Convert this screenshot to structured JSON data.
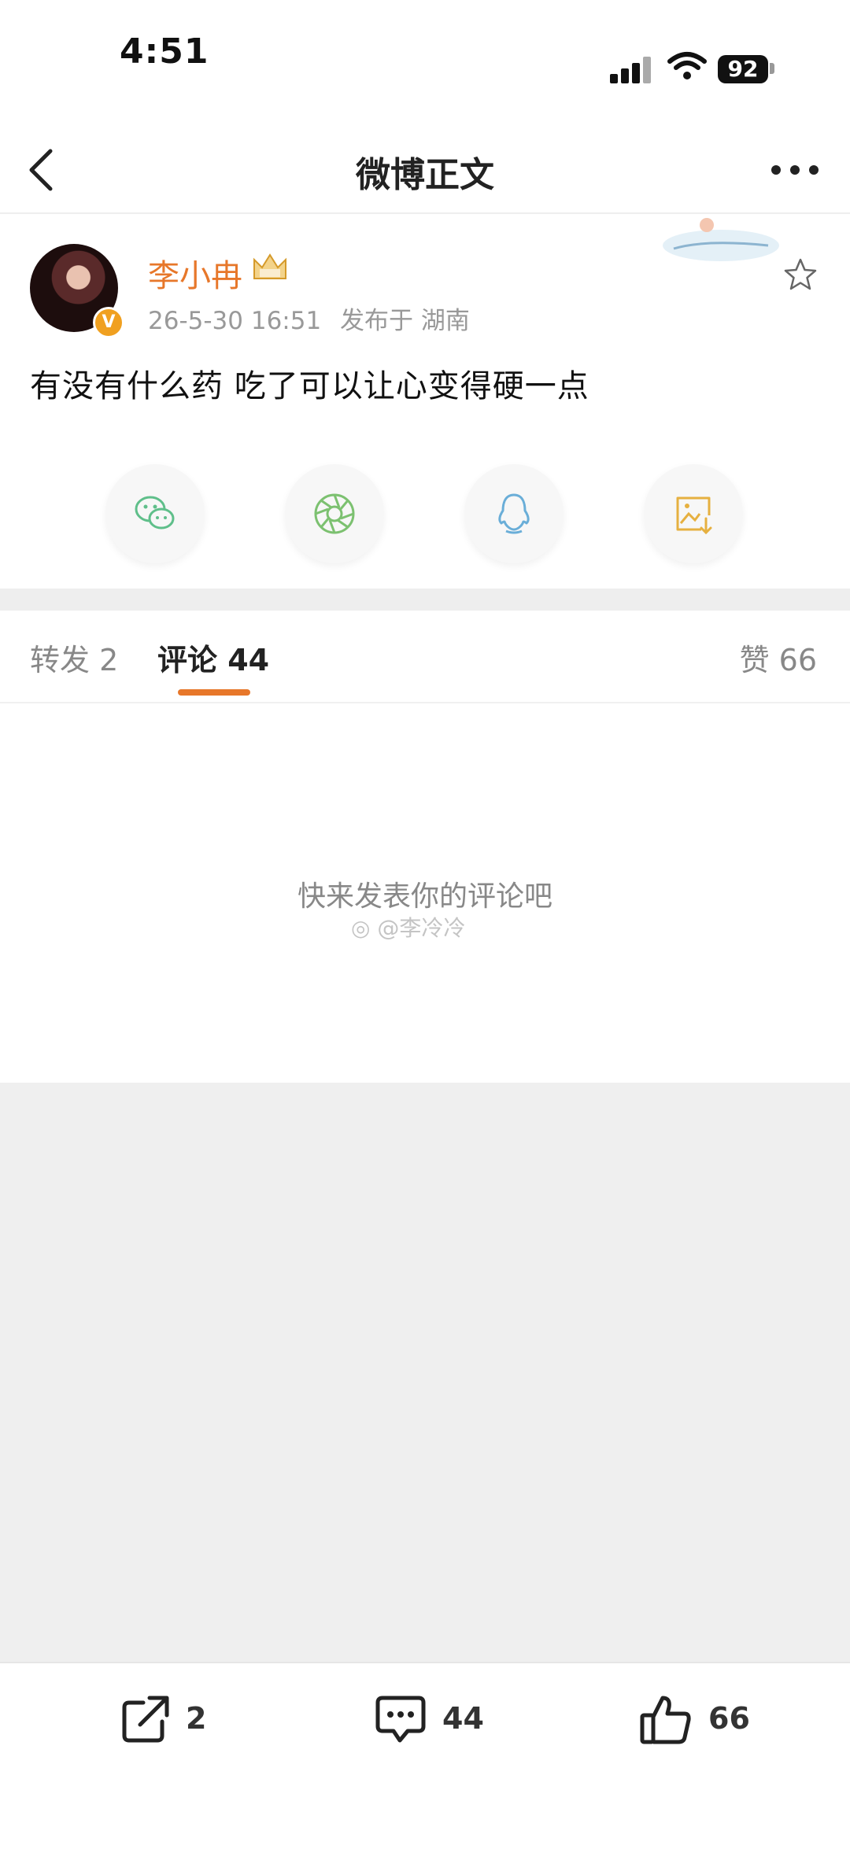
{
  "status_bar": {
    "time": "4:51",
    "battery": "92"
  },
  "nav": {
    "title": "微博正文"
  },
  "post": {
    "author": "李小冉",
    "timestamp": "26-5-30 16:51",
    "location": "发布于 湖南",
    "text": "有没有什么药 吃了可以让心变得硬一点",
    "share_targets": [
      "wechat-icon",
      "moments-icon",
      "qq-icon",
      "save-image-icon"
    ]
  },
  "tabs": {
    "repost": "转发 2",
    "comment": "评论 44",
    "like": "赞 66"
  },
  "comments": {
    "empty_text": "快来发表你的评论吧",
    "watermark": "@李冷冷"
  },
  "toolbar": {
    "repost_count": "2",
    "comment_count": "44",
    "like_count": "66"
  },
  "colors": {
    "accent": "#e7772a",
    "wechat": "#5fbf8a",
    "qq": "#6aaed8",
    "save": "#e6b040"
  }
}
